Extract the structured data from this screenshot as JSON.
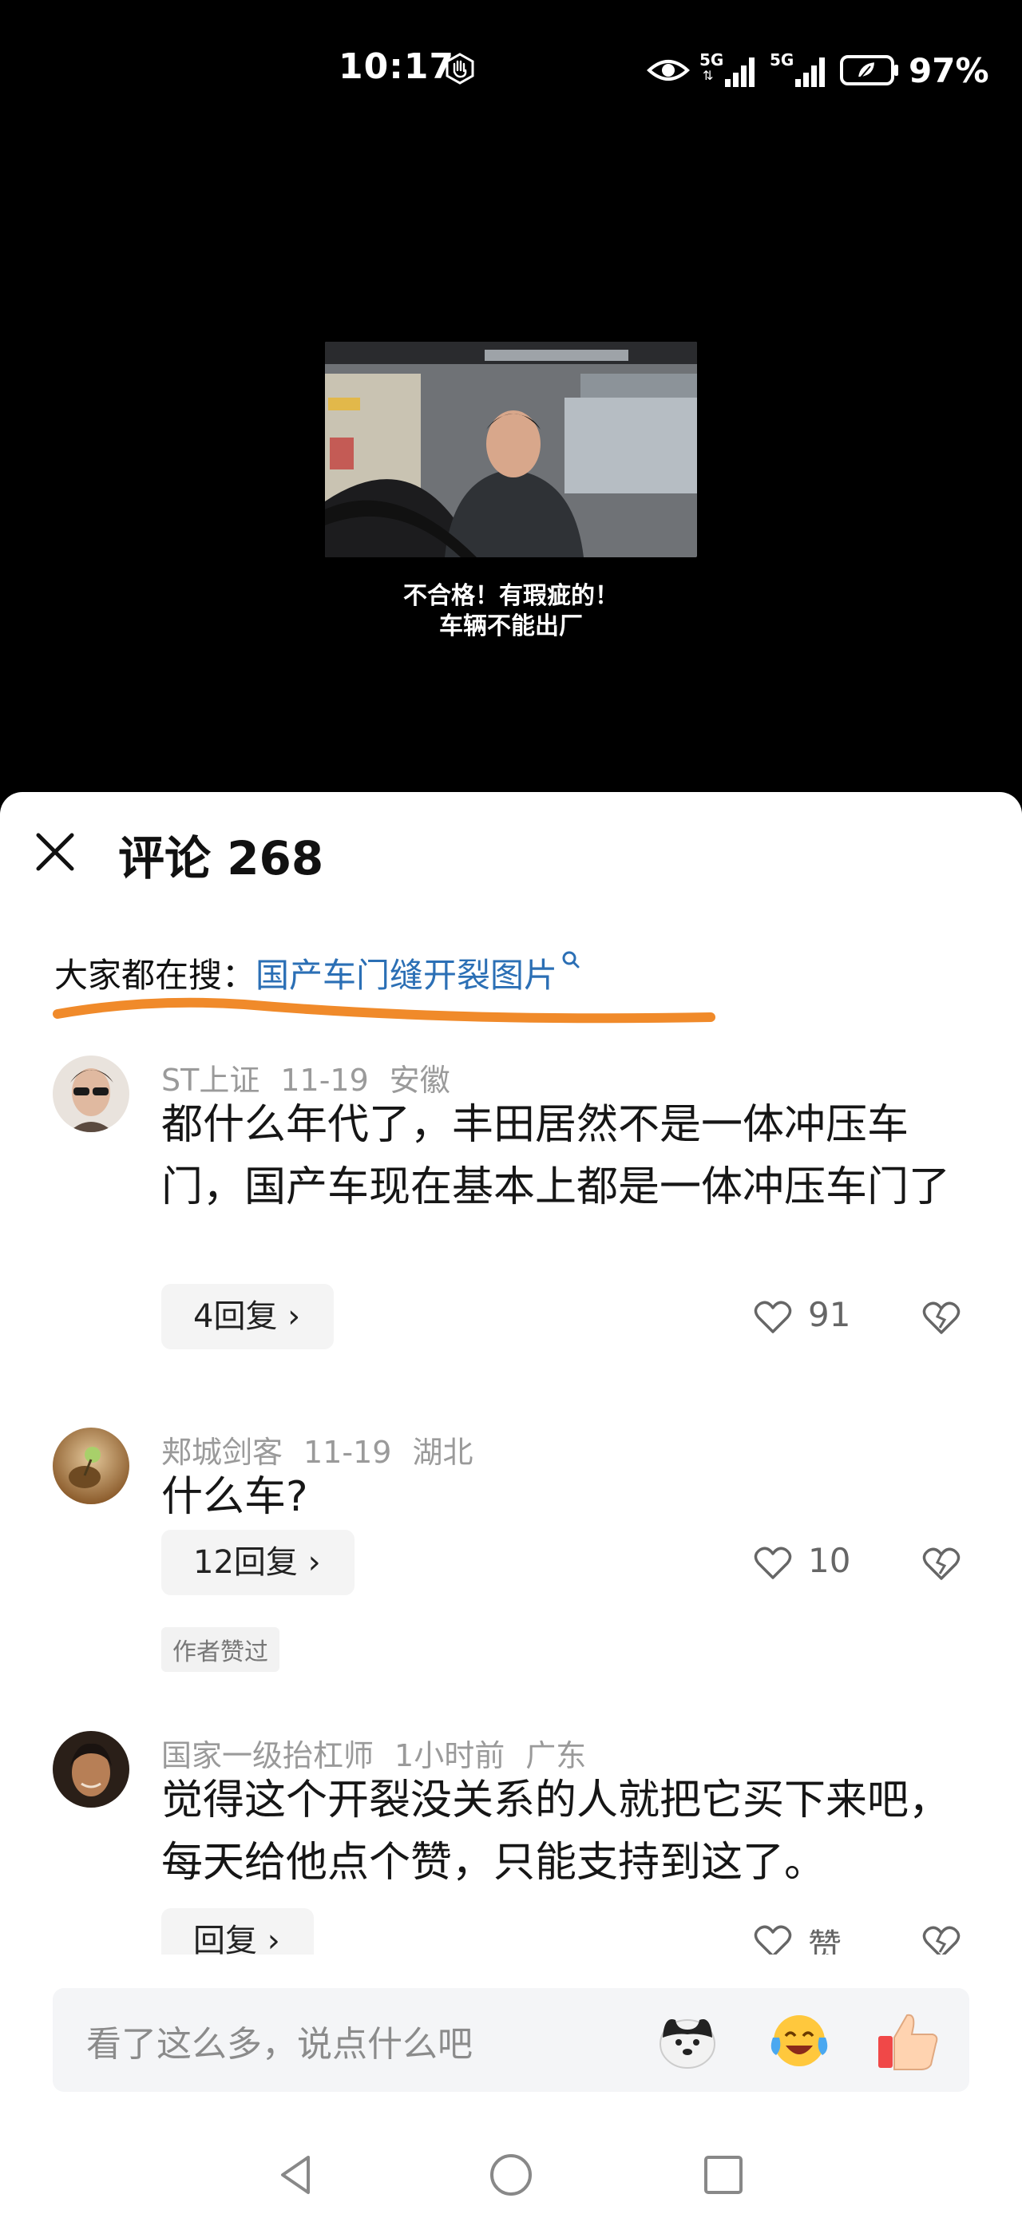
{
  "status_bar": {
    "time": "10:17",
    "network_1": "5G",
    "network_2": "5G",
    "battery": "97%"
  },
  "video": {
    "subtitle_line1": "不合格！有瑕疵的！",
    "subtitle_line2": "车辆不能出厂"
  },
  "comments_panel": {
    "title": "评论 268",
    "search_label": "大家都在搜：",
    "search_query": "国产车门缝开裂图片",
    "underline_color": "#f08a2a",
    "link_color": "#2b6fb5",
    "comments": [
      {
        "user": "ST上证",
        "date": "11-19",
        "location": "安徽",
        "text": "都什么年代了，丰田居然不是一体冲压车门，国产车现在基本上都是一体冲压车门了",
        "replies": "4回复",
        "likes": "91"
      },
      {
        "user": "郏城剑客",
        "date": "11-19",
        "location": "湖北",
        "text": "什么车?",
        "replies": "12回复",
        "likes": "10",
        "badge": "作者赞过"
      },
      {
        "user": "国家一级抬杠师",
        "date": "1小时前",
        "location": "广东",
        "text": "觉得这个开裂没关系的人就把它买下来吧，每天给他点个赞，只能支持到这了。",
        "replies": "回复",
        "likes": "赞"
      }
    ]
  },
  "input": {
    "placeholder": "看了这么多，说点什么吧",
    "emojis": [
      "dog-emoji-icon",
      "laughing-crying-emoji-icon",
      "thumbs-up-icon"
    ]
  },
  "navigation": [
    "back-icon",
    "home-icon",
    "recents-icon"
  ]
}
